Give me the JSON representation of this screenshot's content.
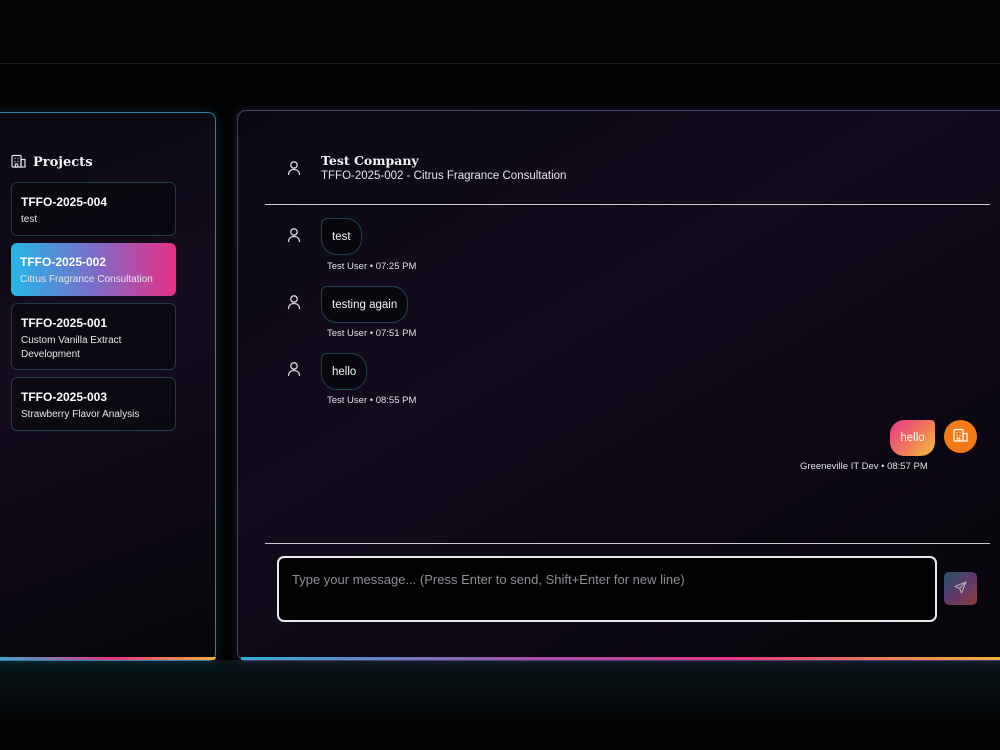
{
  "sidebar": {
    "title": "Projects",
    "projects": [
      {
        "code": "TFFO-2025-004",
        "name": "test"
      },
      {
        "code": "TFFO-2025-002",
        "name": "Citrus Fragrance Consultation"
      },
      {
        "code": "TFFO-2025-001",
        "name": "Custom Vanilla Extract Development"
      },
      {
        "code": "TFFO-2025-003",
        "name": "Strawberry Flavor Analysis"
      }
    ]
  },
  "chat": {
    "company": "Test Company",
    "subtitle": "TFFO-2025-002 - Citrus Fragrance Consultation",
    "messages": [
      {
        "text": "test",
        "meta": "Test User • 07:25 PM"
      },
      {
        "text": "testing again",
        "meta": "Test User • 07:51 PM"
      },
      {
        "text": "hello",
        "meta": "Test User • 08:55 PM"
      }
    ],
    "own_message": {
      "text": "hello",
      "meta": "Greeneville IT Dev • 08:57 PM"
    },
    "composer_placeholder": "Type your message... (Press Enter to send, Shift+Enter for new line)"
  },
  "icons": {
    "projects": "building-icon",
    "user": "user-icon",
    "own_avatar": "building-icon",
    "send": "send-icon"
  },
  "colors": {
    "active_card_gradient": [
      "#25b7e8",
      "#ea2f86"
    ],
    "own_bubble_gradient": [
      "#e7378a",
      "#f5c33d"
    ],
    "avatar": "#f47a16"
  }
}
